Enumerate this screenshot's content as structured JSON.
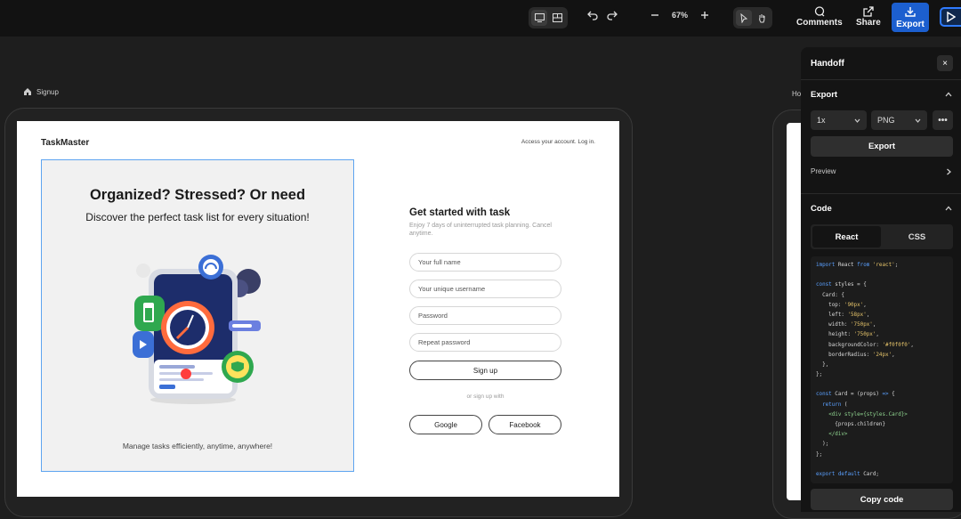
{
  "toolbar": {
    "zoom": "67%",
    "comments_label": "Comments",
    "share_label": "Share",
    "export_label": "Export",
    "accent": "#1c5fcf"
  },
  "canvas": {
    "frame_label": "Signup",
    "frame2_label": "Ho"
  },
  "design": {
    "brand": "TaskMaster",
    "login_link": "Access your account. Log in.",
    "hero_title": "Organized? Stressed? Or need",
    "hero_subtitle": "Discover the perfect task list for every situation!",
    "hero_caption": "Manage tasks efficiently, anytime, anywhere!",
    "form_title": "Get started with task",
    "form_desc": "Enjoy 7 days of uninterrupted task planning. Cancel anytime.",
    "fields": {
      "full_name": "Your full name",
      "username": "Your unique username",
      "password": "Password",
      "repeat_password": "Repeat password"
    },
    "signup_label": "Sign up",
    "or_text": "or sign up with",
    "google_label": "Google",
    "facebook_label": "Facebook"
  },
  "handoff": {
    "title": "Handoff",
    "close_icon": "×",
    "export_section": "Export",
    "scale": "1x",
    "format": "PNG",
    "export_button": "Export",
    "preview_label": "Preview",
    "code_section": "Code",
    "tab_react": "React",
    "tab_css": "CSS",
    "copy_label": "Copy code",
    "code_lines": [
      "import React from 'react';",
      "",
      "const styles = {",
      "  Card: {",
      "    top: '90px',",
      "    left: '58px',",
      "    width: '750px',",
      "    height: '750px',",
      "    backgroundColor: '#f0f0f0',",
      "    borderRadius: '24px',",
      "  },",
      "};",
      "",
      "const Card = (props) => {",
      "  return (",
      "    <div style={styles.Card}>",
      "      {props.children}",
      "    </div>",
      "  );",
      "};",
      "",
      "export default Card;"
    ]
  }
}
